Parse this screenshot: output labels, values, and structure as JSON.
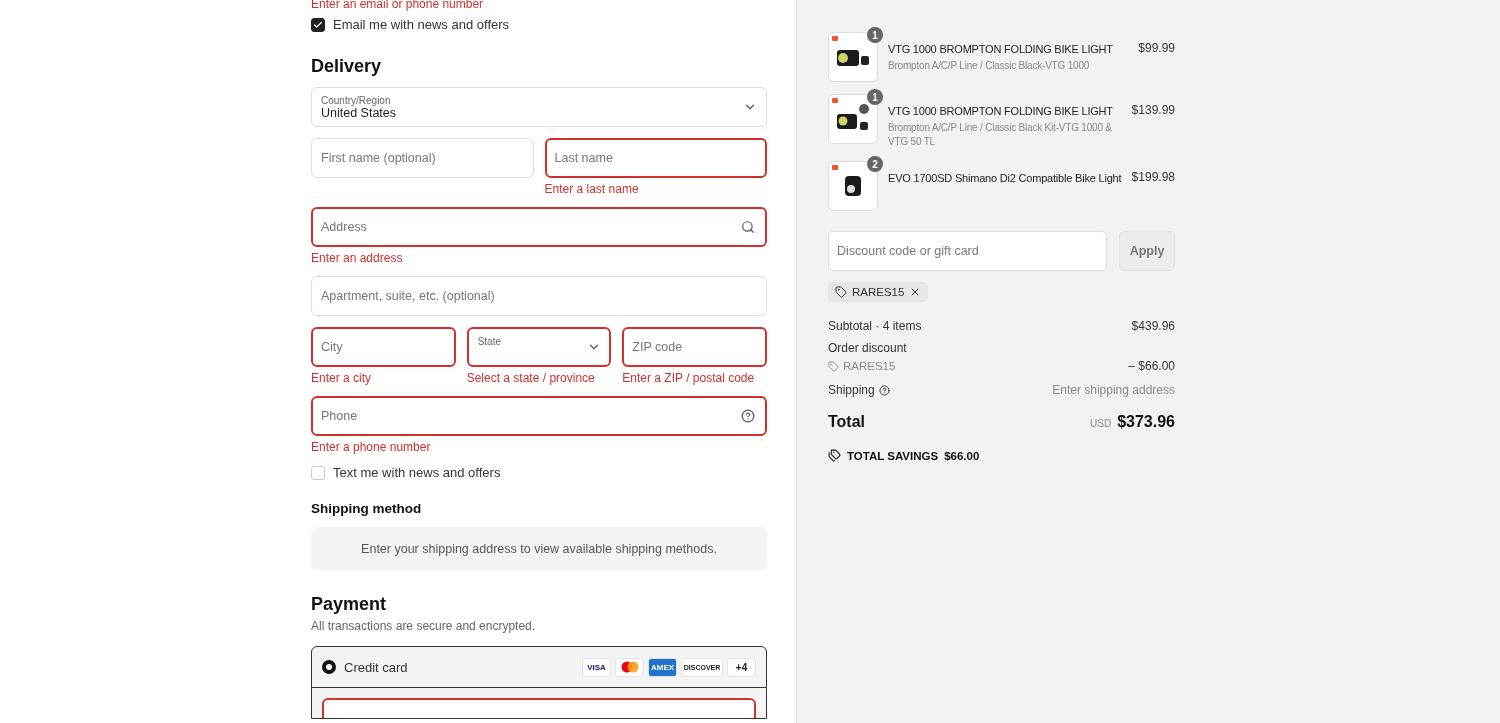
{
  "contact": {
    "error": "Enter an email or phone number",
    "newsletter": {
      "label": "Email me with news and offers",
      "checked": true
    }
  },
  "delivery": {
    "heading": "Delivery",
    "country": {
      "label": "Country/Region",
      "value": "United States"
    },
    "rows": [
      [
        {
          "kind": "text",
          "placeholder": "First name (optional)",
          "invalid": false
        },
        {
          "kind": "text",
          "placeholder": "Last name",
          "invalid": true,
          "error": "Enter a last name"
        }
      ],
      [
        {
          "kind": "search",
          "placeholder": "Address",
          "invalid": true,
          "error": "Enter an address"
        }
      ],
      [
        {
          "kind": "text",
          "placeholder": "Apartment, suite, etc. (optional)",
          "invalid": false
        }
      ],
      [
        {
          "kind": "text",
          "placeholder": "City",
          "invalid": true,
          "error": "Enter a city"
        },
        {
          "kind": "select",
          "placeholder": "State",
          "invalid": true,
          "error": "Select a state / province"
        },
        {
          "kind": "text",
          "placeholder": "ZIP code",
          "invalid": true,
          "error": "Enter a ZIP / postal code"
        }
      ],
      [
        {
          "kind": "help",
          "placeholder": "Phone",
          "invalid": true,
          "error": "Enter a phone number"
        }
      ]
    ],
    "sms": {
      "label": "Text me with news and offers",
      "checked": false
    }
  },
  "shipping": {
    "heading": "Shipping method",
    "notice": "Enter your shipping address to view available shipping methods."
  },
  "payment": {
    "heading": "Payment",
    "subtitle": "All transactions are secure and encrypted.",
    "methods": [
      {
        "label": "Credit card",
        "selected": true,
        "logos": [
          {
            "kind": "visa",
            "label": "VISA"
          },
          {
            "kind": "mastercard"
          },
          {
            "kind": "amex",
            "label": "AMEX"
          },
          {
            "kind": "discover",
            "label": "DISCOVER"
          },
          {
            "kind": "more",
            "label": "+4"
          }
        ]
      }
    ]
  },
  "summary": {
    "items": [
      {
        "name": "VTG 1000 BROMPTON FOLDING BIKE LIGHT",
        "variant": "Brompton A/C/P Line / Classic Black-VTG 1000",
        "price": "$99.99",
        "quantity": "1",
        "kind": "single"
      },
      {
        "name": "VTG 1000 BROMPTON FOLDING BIKE LIGHT",
        "variant": "Brompton A/C/P Line / Classic Black Kit-VTG 1000 & VTG 50 TL",
        "price": "$139.99",
        "quantity": "1",
        "kind": "kit"
      },
      {
        "name": "EVO 1700SD Shimano Di2 Compatible Bike Light",
        "price": "$199.98",
        "quantity": "2",
        "kind": "evo"
      }
    ],
    "discount": {
      "placeholder": "Discount code or gift card",
      "button": "Apply",
      "code": "RARES15"
    },
    "lines": [
      {
        "label": "Subtotal · 4 items",
        "value": "$439.96"
      },
      {
        "label": "Order discount",
        "code": "RARES15",
        "value": "– $66.00"
      },
      {
        "label": "Shipping",
        "value": "Enter shipping address",
        "help": true
      }
    ],
    "total": {
      "label": "Total",
      "currency": "USD",
      "value": "$373.96"
    },
    "savings": {
      "label": "TOTAL SAVINGS",
      "value": "$66.00"
    }
  }
}
